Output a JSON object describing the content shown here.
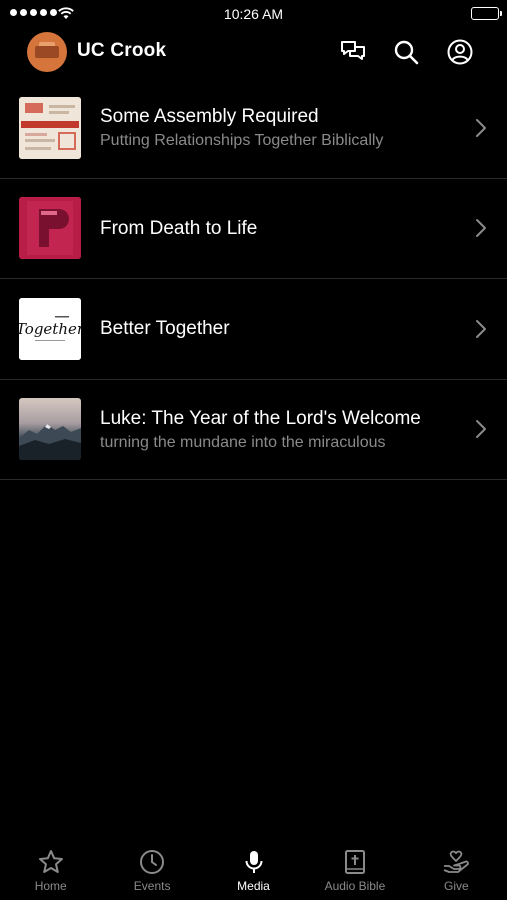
{
  "status_bar": {
    "time": "10:26 AM"
  },
  "header": {
    "title": "UC Crook"
  },
  "media": {
    "items": [
      {
        "title": "Some Assembly Required",
        "subtitle": "Putting Relationships Together Biblically",
        "thumb": "assembly"
      },
      {
        "title": "From Death to Life",
        "subtitle": "",
        "thumb": "death"
      },
      {
        "title": "Better Together",
        "subtitle": "",
        "thumb": "together",
        "thumb_text": "Together"
      },
      {
        "title": "Luke: The Year of the Lord's Welcome",
        "subtitle": "turning the mundane into the miraculous",
        "thumb": "luke"
      }
    ]
  },
  "tabs": [
    {
      "label": "Home",
      "icon": "star-icon"
    },
    {
      "label": "Events",
      "icon": "clock-icon"
    },
    {
      "label": "Media",
      "icon": "microphone-icon",
      "active": true
    },
    {
      "label": "Audio Bible",
      "icon": "bible-icon"
    },
    {
      "label": "Give",
      "icon": "give-heart-icon"
    }
  ],
  "colors": {
    "background": "#000000",
    "active_tab": "#ffffff",
    "inactive_tab": "#8a8a8a",
    "logo": "#d5753c"
  }
}
